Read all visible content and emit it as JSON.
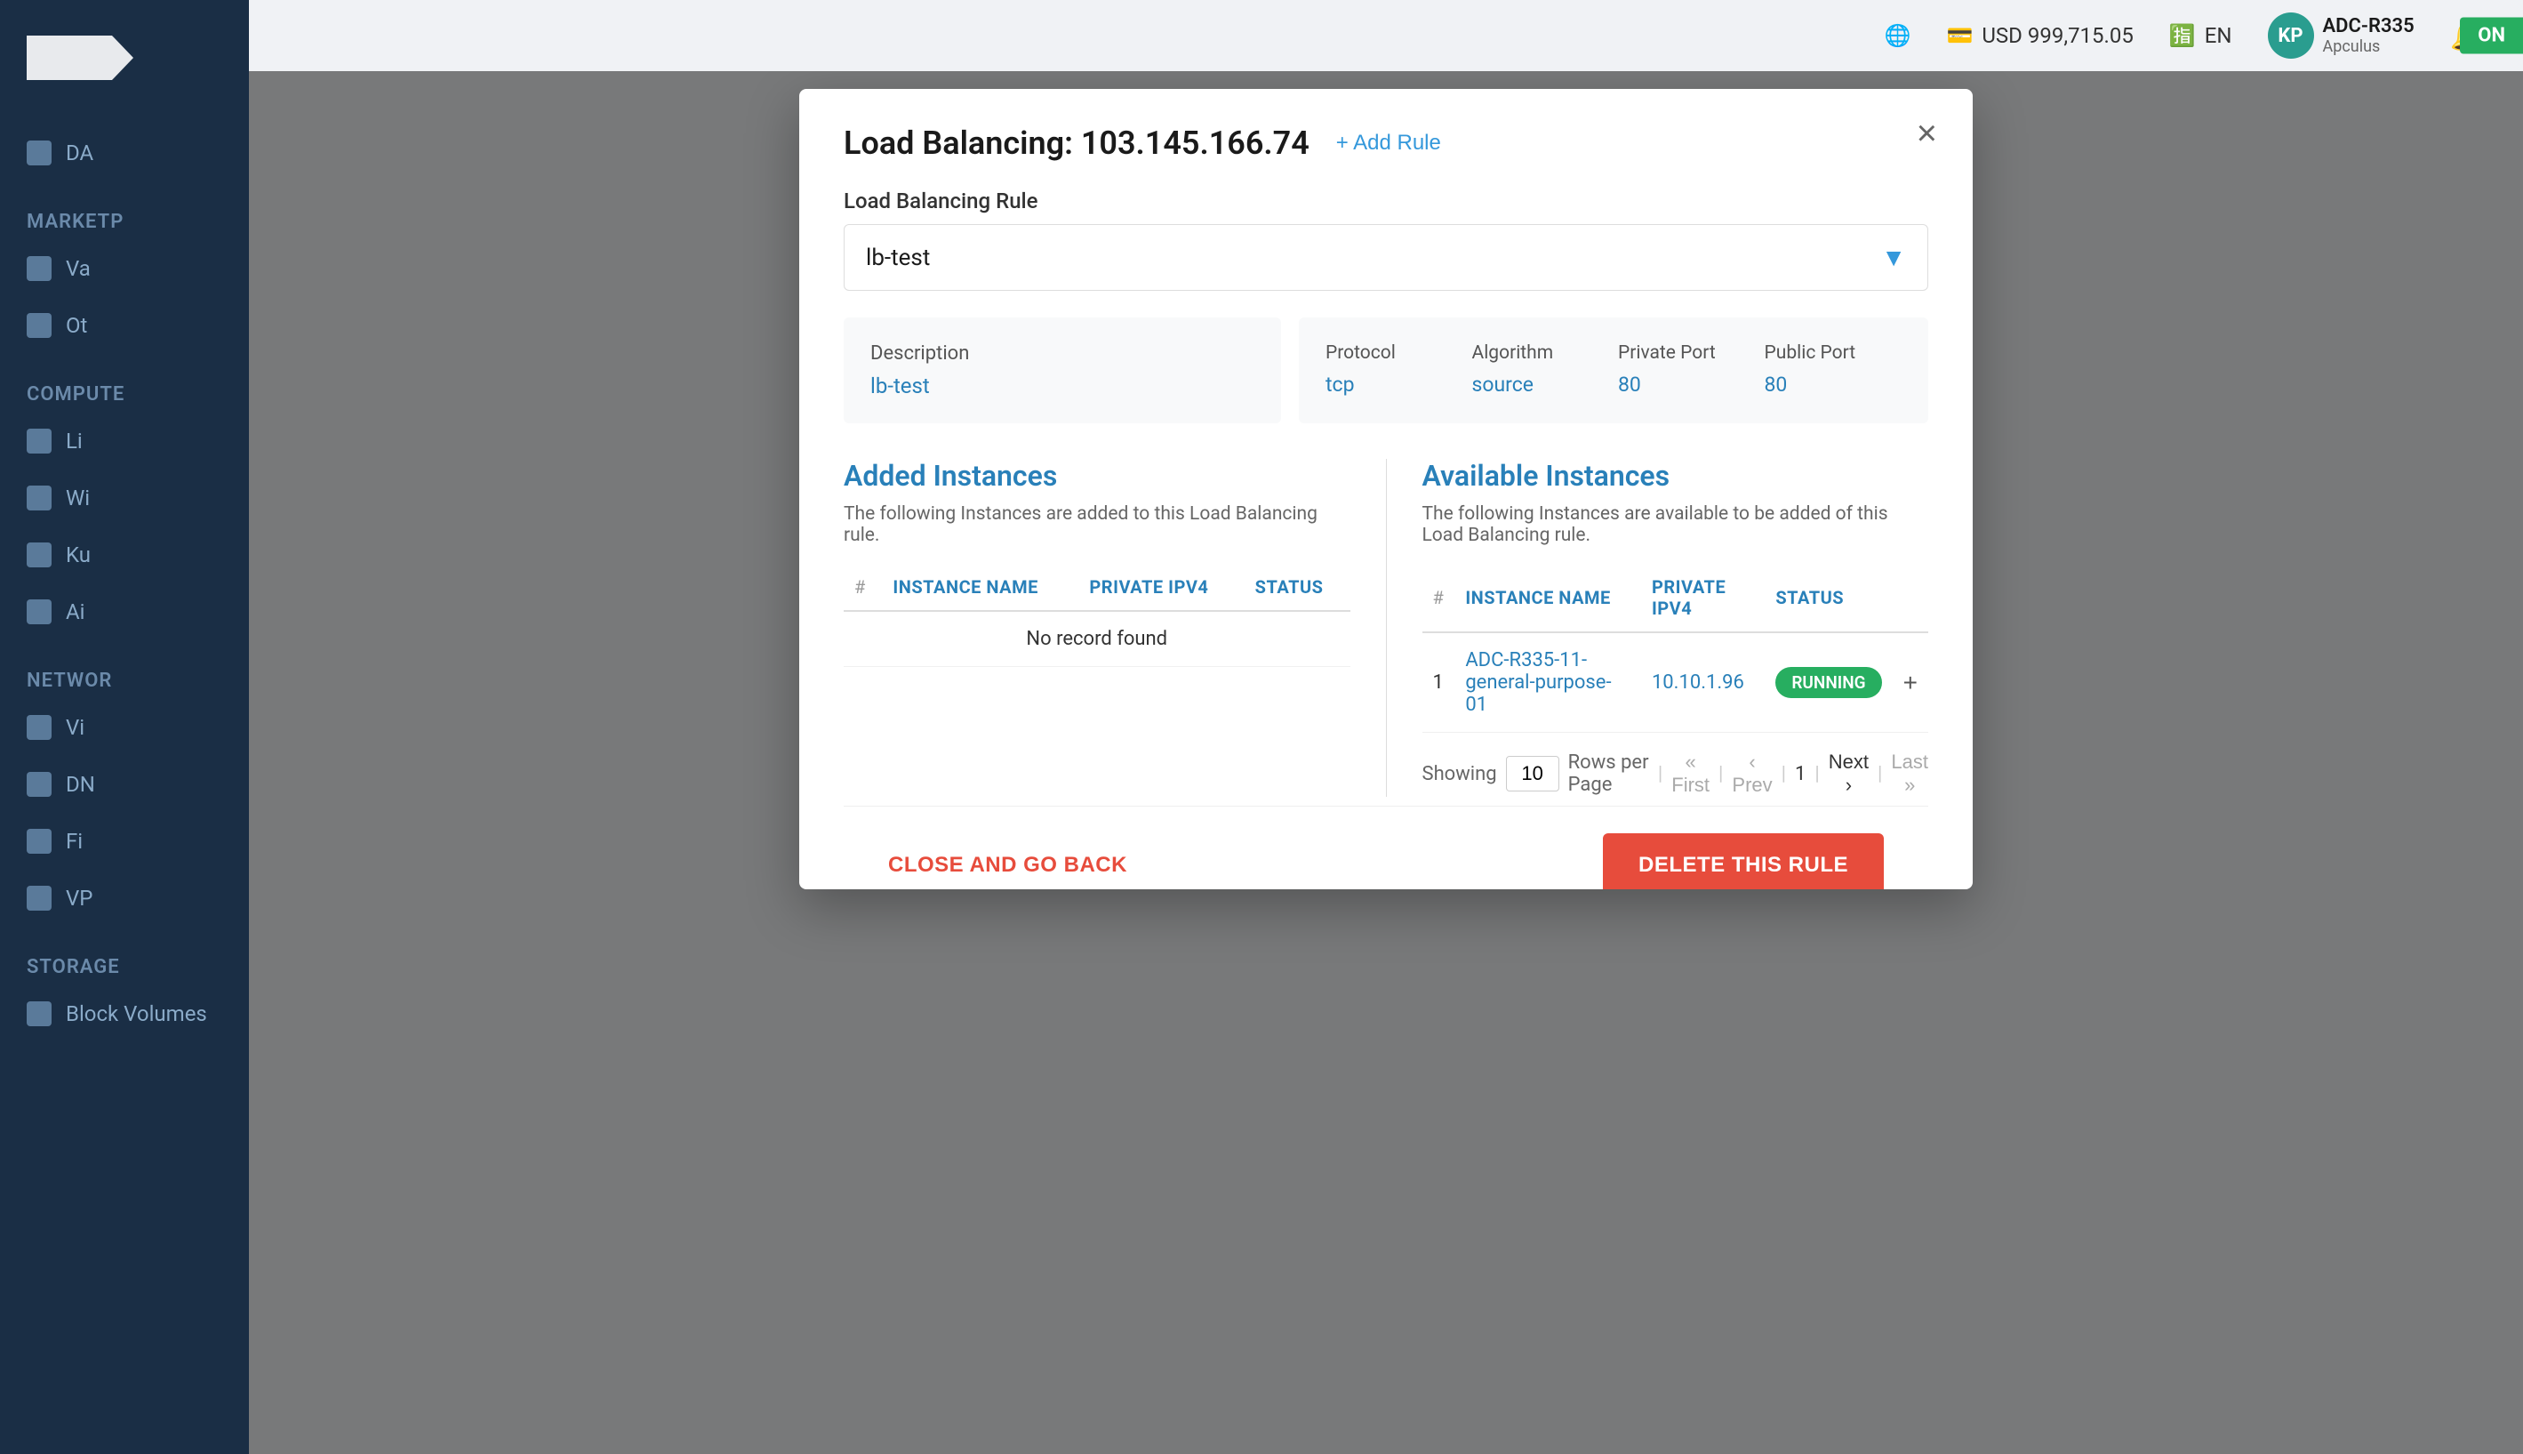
{
  "sidebar": {
    "sections": [
      {
        "label": "DA",
        "items": [
          {
            "icon": "dashboard-icon",
            "label": "DA"
          }
        ]
      },
      {
        "label": "MARKETP",
        "items": [
          {
            "icon": "va-icon",
            "label": "Va"
          },
          {
            "icon": "ot-icon",
            "label": "Ot"
          }
        ]
      },
      {
        "label": "COMPUTE",
        "items": [
          {
            "icon": "li-icon",
            "label": "Li"
          },
          {
            "icon": "wi-icon",
            "label": "Wi"
          },
          {
            "icon": "ku-icon",
            "label": "Ku"
          },
          {
            "icon": "ai-icon",
            "label": "Ai"
          }
        ]
      },
      {
        "label": "NETWOR",
        "items": [
          {
            "icon": "vi-icon",
            "label": "Vi"
          },
          {
            "icon": "dn-icon",
            "label": "DN"
          },
          {
            "icon": "fi-icon",
            "label": "Fi"
          },
          {
            "icon": "vp-icon",
            "label": "VP"
          }
        ]
      },
      {
        "label": "STORAGE",
        "items": [
          {
            "icon": "block-volumes-icon",
            "label": "Block Volumes"
          }
        ]
      }
    ]
  },
  "topbar": {
    "globe_icon": "globe-icon",
    "currency": "USD 999,715.05",
    "language": "EN",
    "user_initials": "KP",
    "user_name": "ADC-R335",
    "user_subtitle": "Apculus",
    "bell_icon": "bell-icon",
    "on_badge": "ON"
  },
  "modal": {
    "title": "Load Balancing: 103.145.166.74",
    "add_rule_label": "+ Add Rule",
    "close_label": "×",
    "rule_label": "Load Balancing Rule",
    "rule_value": "lb-test",
    "chevron": "▼",
    "info": {
      "description_label": "Description",
      "description_value": "lb-test",
      "protocol_label": "Protocol",
      "protocol_value": "tcp",
      "algorithm_label": "Algorithm",
      "algorithm_value": "source",
      "private_port_label": "Private Port",
      "private_port_value": "80",
      "public_port_label": "Public Port",
      "public_port_value": "80"
    },
    "added_instances": {
      "title": "Added Instances",
      "description": "The following Instances are added to this Load Balancing rule.",
      "columns": {
        "hash": "#",
        "name": "INSTANCE NAME",
        "ipv4": "PRIVATE IPV4",
        "status": "STATUS"
      },
      "empty_message": "No record found",
      "rows": []
    },
    "available_instances": {
      "title": "Available Instances",
      "description": "The following Instances are available to be added of this Load Balancing rule.",
      "columns": {
        "hash": "#",
        "name": "INSTANCE NAME",
        "ipv4": "PRIVATE IPV4",
        "status": "STATUS"
      },
      "rows": [
        {
          "num": "1",
          "name": "ADC-R335-11-general-purpose-01",
          "ipv4": "10.10.1.96",
          "status": "RUNNING"
        }
      ],
      "pagination": {
        "showing_label": "Showing",
        "rows_value": "10",
        "rows_per_page_label": "Rows per Page",
        "first_label": "« First",
        "prev_label": "‹ Prev",
        "page_num": "1",
        "next_label": "Next ›",
        "last_label": "Last »"
      }
    },
    "footer": {
      "close_back_label": "CLOSE AND GO BACK",
      "delete_rule_label": "DELETE THIS RULE"
    }
  }
}
